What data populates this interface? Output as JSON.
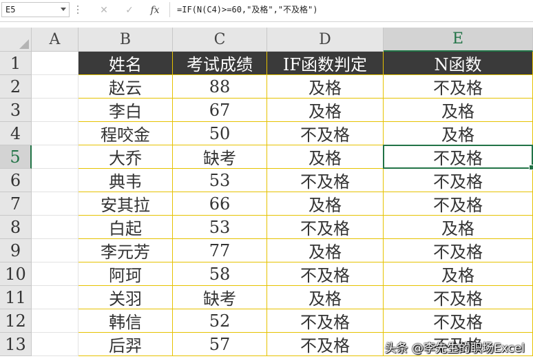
{
  "name_box": {
    "value": "E5"
  },
  "formula_bar": {
    "cancel_icon": "close-icon",
    "enter_icon": "check-icon",
    "fx_label": "fx",
    "formula": "=IF(N(C4)>=60,\"及格\",\"不及格\")"
  },
  "columns": [
    "A",
    "B",
    "C",
    "D",
    "E"
  ],
  "selected_column": "E",
  "selected_row": "5",
  "headers": {
    "b": "姓名",
    "c": "考试成绩",
    "d": "IF函数判定",
    "e": "N函数"
  },
  "rows": [
    {
      "num": "2",
      "b": "赵云",
      "c": "88",
      "d": "及格",
      "e": "不及格"
    },
    {
      "num": "3",
      "b": "李白",
      "c": "67",
      "d": "及格",
      "e": "及格"
    },
    {
      "num": "4",
      "b": "程咬金",
      "c": "50",
      "d": "不及格",
      "e": "及格"
    },
    {
      "num": "5",
      "b": "大乔",
      "c": "缺考",
      "d": "及格",
      "e": "不及格"
    },
    {
      "num": "6",
      "b": "典韦",
      "c": "53",
      "d": "不及格",
      "e": "不及格"
    },
    {
      "num": "7",
      "b": "安其拉",
      "c": "66",
      "d": "及格",
      "e": "不及格"
    },
    {
      "num": "8",
      "b": "白起",
      "c": "53",
      "d": "不及格",
      "e": "及格"
    },
    {
      "num": "9",
      "b": "李元芳",
      "c": "77",
      "d": "及格",
      "e": "不及格"
    },
    {
      "num": "10",
      "b": "阿珂",
      "c": "58",
      "d": "不及格",
      "e": "及格"
    },
    {
      "num": "11",
      "b": "关羽",
      "c": "缺考",
      "d": "及格",
      "e": "不及格"
    },
    {
      "num": "12",
      "b": "韩信",
      "c": "52",
      "d": "不及格",
      "e": "不及格"
    },
    {
      "num": "13",
      "b": "后羿",
      "c": "57",
      "d": "不及格",
      "e": "不及格"
    }
  ],
  "header_row_num": "1",
  "watermark": "头条 @李先生的职场Excel",
  "colors": {
    "header_bg": "#3a3a3a",
    "table_border": "#e6c200",
    "selection": "#217346"
  }
}
